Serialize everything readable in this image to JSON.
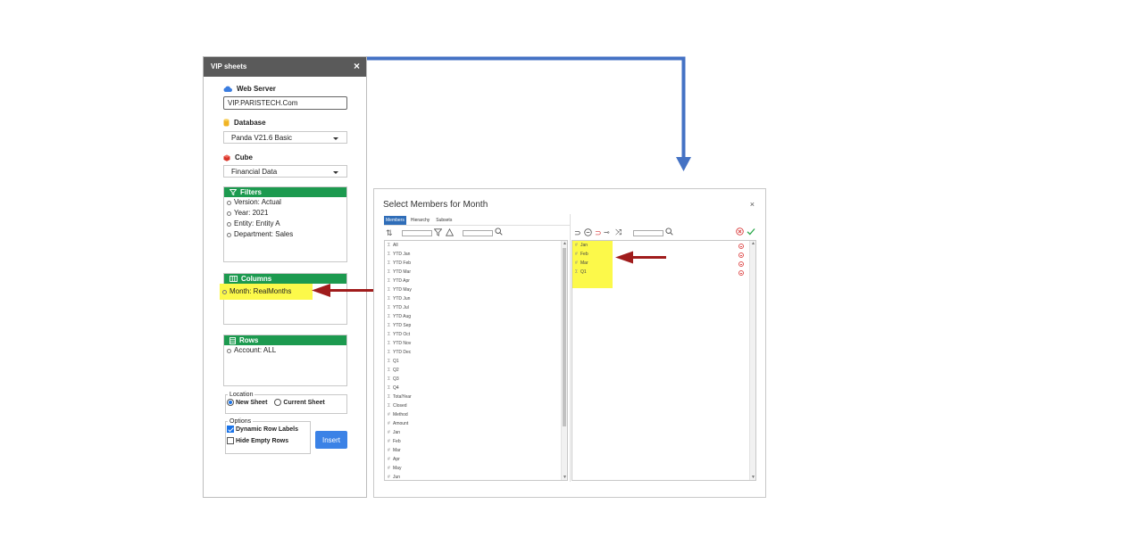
{
  "panel": {
    "title": "VIP sheets",
    "close": "×",
    "web_server": {
      "label": "Web Server",
      "value": "VIP.PARISTECH.Com"
    },
    "database": {
      "label": "Database",
      "value": "Panda V21.6 Basic"
    },
    "cube": {
      "label": "Cube",
      "value": "Financial Data"
    },
    "filters": {
      "label": "Filters",
      "items": [
        "Version: Actual",
        "Year: 2021",
        "Entity: Entity A",
        "Department: Sales"
      ]
    },
    "columns": {
      "label": "Columns",
      "items": [
        "Month: RealMonths"
      ]
    },
    "rows": {
      "label": "Rows",
      "items": [
        "Account: ALL"
      ]
    },
    "location": {
      "legend": "Location",
      "new_sheet": "New Sheet",
      "current_sheet": "Current Sheet"
    },
    "options": {
      "legend": "Options",
      "dynamic_row_labels": "Dynamic Row Labels",
      "hide_empty_rows": "Hide Empty Rows"
    },
    "insert": "Insert"
  },
  "dialog": {
    "title": "Select Members for Month",
    "close": "×",
    "tabs": [
      "Members",
      "Hierarchy",
      "Subsets"
    ],
    "members": [
      {
        "sym": "Σ",
        "label": "All"
      },
      {
        "sym": "Σ",
        "label": "YTD Jan"
      },
      {
        "sym": "Σ",
        "label": "YTD Feb"
      },
      {
        "sym": "Σ",
        "label": "YTD Mar"
      },
      {
        "sym": "Σ",
        "label": "YTD Apr"
      },
      {
        "sym": "Σ",
        "label": "YTD May"
      },
      {
        "sym": "Σ",
        "label": "YTD Jun"
      },
      {
        "sym": "Σ",
        "label": "YTD Jul"
      },
      {
        "sym": "Σ",
        "label": "YTD Aug"
      },
      {
        "sym": "Σ",
        "label": "YTD Sep"
      },
      {
        "sym": "Σ",
        "label": "YTD Oct"
      },
      {
        "sym": "Σ",
        "label": "YTD Nov"
      },
      {
        "sym": "Σ",
        "label": "YTD Dec"
      },
      {
        "sym": "Σ",
        "label": "Q1"
      },
      {
        "sym": "Σ",
        "label": "Q2"
      },
      {
        "sym": "Σ",
        "label": "Q3"
      },
      {
        "sym": "Σ",
        "label": "Q4"
      },
      {
        "sym": "Σ",
        "label": "TotalYear"
      },
      {
        "sym": "Σ",
        "label": "Closed"
      },
      {
        "sym": "#",
        "label": "Method"
      },
      {
        "sym": "#",
        "label": "Amount"
      },
      {
        "sym": "#",
        "label": "Jan"
      },
      {
        "sym": "#",
        "label": "Feb"
      },
      {
        "sym": "#",
        "label": "Mar"
      },
      {
        "sym": "#",
        "label": "Apr"
      },
      {
        "sym": "#",
        "label": "May"
      },
      {
        "sym": "#",
        "label": "Jun"
      }
    ],
    "selected": [
      {
        "sym": "#",
        "label": "Jan"
      },
      {
        "sym": "#",
        "label": "Feb"
      },
      {
        "sym": "#",
        "label": "Mar"
      },
      {
        "sym": "Σ",
        "label": "Q1"
      }
    ]
  },
  "colors": {
    "header_gray": "#5a5a5a",
    "section_green": "#1c9a4f",
    "insert_blue": "#3b82e6",
    "highlight_yellow": "#fcf94a",
    "connector_blue": "#4472c4",
    "arrow_red": "#a01c1c"
  }
}
